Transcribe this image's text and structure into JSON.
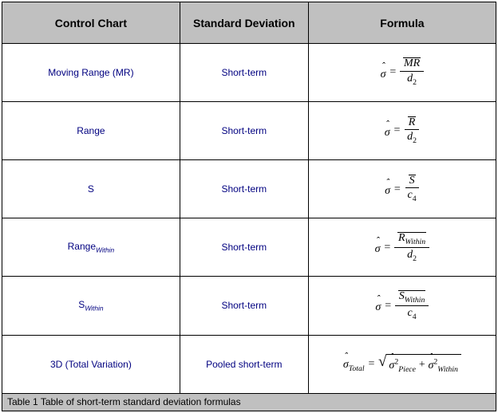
{
  "headers": {
    "c1": "Control Chart",
    "c2": "Standard Deviation",
    "c3": "Formula"
  },
  "rows": [
    {
      "name": "Moving Range (MR)",
      "sub": "",
      "dev": "Short-term"
    },
    {
      "name": "Range",
      "sub": "",
      "dev": "Short-term"
    },
    {
      "name": "S",
      "sub": "",
      "dev": "Short-term"
    },
    {
      "name": "Range",
      "sub": "Within",
      "dev": "Short-term"
    },
    {
      "name": "S",
      "sub": "Within",
      "dev": "Short-term"
    },
    {
      "name": "3D (Total Variation)",
      "sub": "",
      "dev": "Pooled short-term"
    }
  ],
  "formula": {
    "sigma": "σ",
    "eq": "=",
    "plus": "+",
    "d2": "d",
    "d2i": "2",
    "c4": "c",
    "c4i": "4",
    "MR": "MR",
    "R": "R",
    "S": "S",
    "RWithin": "R",
    "RWithin_sub": "Within",
    "SWithin": "S",
    "SWithin_sub": "Within",
    "Total": "Total",
    "Piece": "Piece",
    "Within": "Within"
  },
  "caption": "Table 1 Table of short-term standard deviation formulas",
  "chart_data": {
    "type": "table",
    "title": "Table of short-term standard deviation formulas",
    "columns": [
      "Control Chart",
      "Standard Deviation",
      "Formula"
    ],
    "rows": [
      [
        "Moving Range (MR)",
        "Short-term",
        "sigma_hat = MR_bar / d2"
      ],
      [
        "Range",
        "Short-term",
        "sigma_hat = R_bar / d2"
      ],
      [
        "S",
        "Short-term",
        "sigma_hat = S_bar / c4"
      ],
      [
        "Range_Within",
        "Short-term",
        "sigma_hat = R_bar_Within / d2"
      ],
      [
        "S_Within",
        "Short-term",
        "sigma_hat = S_bar_Within / c4"
      ],
      [
        "3D (Total Variation)",
        "Pooled short-term",
        "sigma_hat_Total = sqrt( sigma_hat_Piece^2 + sigma_hat_Within^2 )"
      ]
    ]
  }
}
